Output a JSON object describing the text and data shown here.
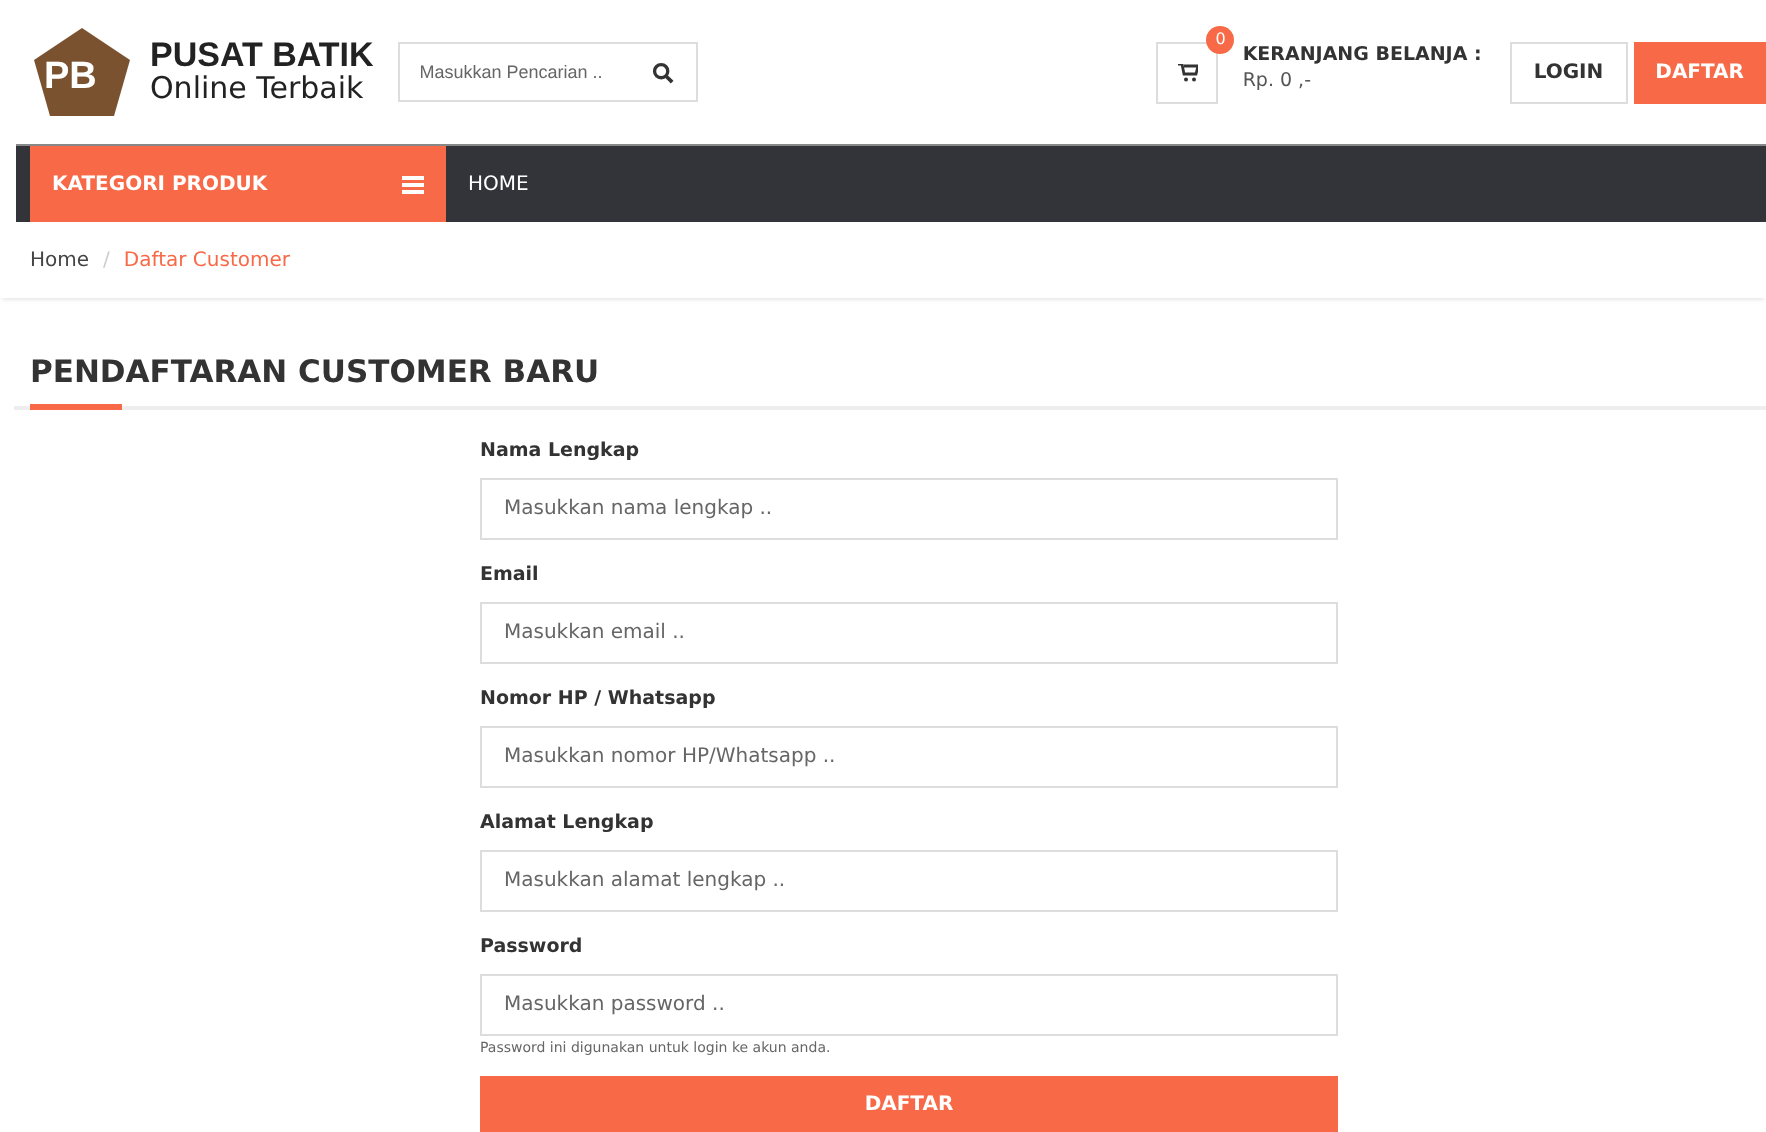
{
  "logo": {
    "letters": "PB",
    "line1": "PUSAT BATIK",
    "line2": "Online Terbaik"
  },
  "search": {
    "placeholder": "Masukkan Pencarian .."
  },
  "cart": {
    "count": "0",
    "title": "KERANJANG BELANJA :",
    "total": "Rp. 0 ,-"
  },
  "auth_buttons": [
    {
      "label": "LOGIN",
      "kind": "outline"
    },
    {
      "label": "DAFTAR",
      "kind": "primary"
    }
  ],
  "nav": {
    "category": "KATEGORI PRODUK",
    "items": [
      "HOME"
    ]
  },
  "breadcrumb": [
    {
      "label": "Home",
      "current": false
    },
    {
      "label": "Daftar Customer",
      "current": true
    }
  ],
  "breadcrumb_separator": "/",
  "page_title": "PENDAFTARAN CUSTOMER BARU",
  "form": {
    "fields": [
      {
        "label": "Nama Lengkap",
        "placeholder": "Masukkan nama lengkap .."
      },
      {
        "label": "Email",
        "placeholder": "Masukkan email .."
      },
      {
        "label": "Nomor HP / Whatsapp",
        "placeholder": "Masukkan nomor HP/Whatsapp .."
      },
      {
        "label": "Alamat Lengkap",
        "placeholder": "Masukkan alamat lengkap .."
      },
      {
        "label": "Password",
        "placeholder": "Masukkan password ..",
        "help": "Password ini digunakan untuk login ke akun anda."
      }
    ],
    "submit": "DAFTAR"
  }
}
